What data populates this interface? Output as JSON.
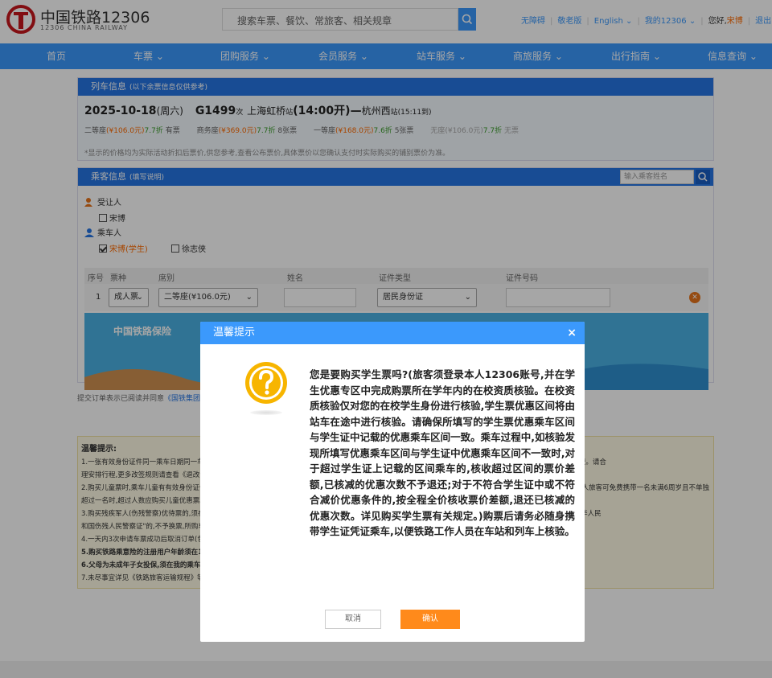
{
  "header": {
    "brand_cn": "中国铁路12306",
    "brand_en": "12306 CHINA RAILWAY",
    "search_placeholder": "搜索车票、餐饮、常旅客、相关规章",
    "links": {
      "accessible": "无障碍",
      "elder": "敬老版",
      "english": "English",
      "my12306": "我的12306",
      "greeting": "您好,",
      "user": "宋博",
      "logout": "退出"
    }
  },
  "nav": {
    "items": [
      "首页",
      "车票 ⌄",
      "团购服务 ⌄",
      "会员服务 ⌄",
      "站车服务 ⌄",
      "商旅服务 ⌄",
      "出行指南 ⌄",
      "信息查询 ⌄"
    ]
  },
  "train_info": {
    "panel_title": "列车信息",
    "panel_note": "(以下余票信息仅供参考)",
    "date": "2025-10-18",
    "weekday": "(周六)",
    "train_no": "G1499",
    "train_suffix": "次",
    "from": "上海虹桥",
    "from_suffix": "站",
    "depart": "(14:00开)",
    "dash": "—",
    "to": "杭州西",
    "to_suffix": "站",
    "arrive": "(15:11到)",
    "seats": [
      {
        "name": "二等座",
        "price": "(¥106.0元)",
        "discount": "7.7折",
        "stock": "有票"
      },
      {
        "name": "商务座",
        "price": "(¥369.0元)",
        "discount": "7.7折",
        "stock": "8张票"
      },
      {
        "name": "一等座",
        "price": "(¥168.0元)",
        "discount": "7.6折",
        "stock": "5张票"
      },
      {
        "name": "无座",
        "price": "(¥106.0元)",
        "discount": "7.7折",
        "stock": "无票"
      }
    ],
    "note": "*显示的价格均为实际活动折扣后票价,供您参考,查看公布票价,具体票价以您确认支付时实际购买的铺别票价为准。"
  },
  "passenger_info": {
    "panel_title": "乘客信息",
    "panel_note": "(填写说明)",
    "search_placeholder": "输入乘客姓名",
    "grantee_label": "受让人",
    "grantee_name": "宋博",
    "rider_label": "乘车人",
    "rider_1": "宋博(学生)",
    "rider_2": "徐志侠",
    "columns": [
      "序号",
      "票种",
      "席别",
      "姓名",
      "证件类型",
      "证件号码"
    ],
    "row": {
      "index": "1",
      "ticket_type": "成人票",
      "seat": "二等座(¥106.0元)",
      "id_type": "居民身份证"
    },
    "banner_logo": "中国铁路保险"
  },
  "agreement": {
    "text": "提交订单表示已阅读并同意",
    "link": "《国铁集团铁路旅客运输规程》"
  },
  "tips": {
    "title": "温馨提示:",
    "lines": [
      "1.一张有效身份证件同一乘车日期同一车次只能购买一张车票,高铁动卧列车除外。改签或变更到站后车票的乘车日期在春运期间,退票时一律按票面价格20%核收退票费。请合",
      "理安排行程,更多改签规则请查看《退改说明》。",
      "2.购买儿童票时,乘车儿童有有效身份证件的,请填写本人有效身份证件信息。乘车儿童没有有效身份证件的,应使用同行成年人的有效身份证件信息购票;每一名持票成年人旅客可免费携带一名未满6周岁且不单独占用席位的儿童乘车,",
      "超过一名时,超过人数应购买儿童优惠票。",
      "3.购买残疾军人(伤残警察)优待票的,须在购票后、开车前办理换票手续方可进站乘车。换票时,不符合规定的减价优待条件,没有有效\"中华人民共和国残疾军人证\"或\"中华人民",
      "和国伤残人民警察证\"的,不予换票,所购车票按规定办理退票手续。",
      "4.一天内3次申请车票成功后取消订单(包含无座票时取消5次计为取消1次),当日将不能在12306继续购票。",
      "5.购买铁路乘意险的注册用户年龄须在18周岁以上,使用非中国居民身份证注册的用户如购买铁路乘意险,须在\"我的12306——个人信息\"如实填写\"出生日期\"。",
      "6.父母为未成年子女投保,须在我的乘车人登记未成年子女的有效身份证件信息。",
      "7.未尽事宜详见《铁路旅客运输规程》等有关规定和车站公告。"
    ]
  },
  "dialog": {
    "title": "温馨提示",
    "close": "×",
    "message": "您是要购买学生票吗?(旅客须登录本人12306账号,并在学生优惠专区中完成购票所在学年内的在校资质核验。在校资质核验仅对您的在校学生身份进行核验,学生票优惠区间将由站车在途中进行核验。请确保所填写的学生票优惠乘车区间与学生证中记载的优惠乘车区间一致。乘车过程中,如核验发现所填写优惠乘车区间与学生证中优惠乘车区间不一致时,对于超过学生证上记载的区间乘车的,核收超过区间的票价差额,已核减的优惠次数不予退还;对于不符合学生证中或不符合减价优惠条件的,按全程全价核收票价差额,退还已核减的优惠次数。详见购买学生票有关规定。)购票后请务必随身携带学生证凭证乘车,以便铁路工作人员在车站和列车上核验。",
    "cancel": "取消",
    "confirm": "确认"
  },
  "colors": {
    "nav_blue": "#3b99fc",
    "panel_blue": "#2676e3",
    "accent_orange": "#ff8a1b",
    "price_orange": "#ff6b00",
    "discount_green": "#3a9c2a"
  }
}
